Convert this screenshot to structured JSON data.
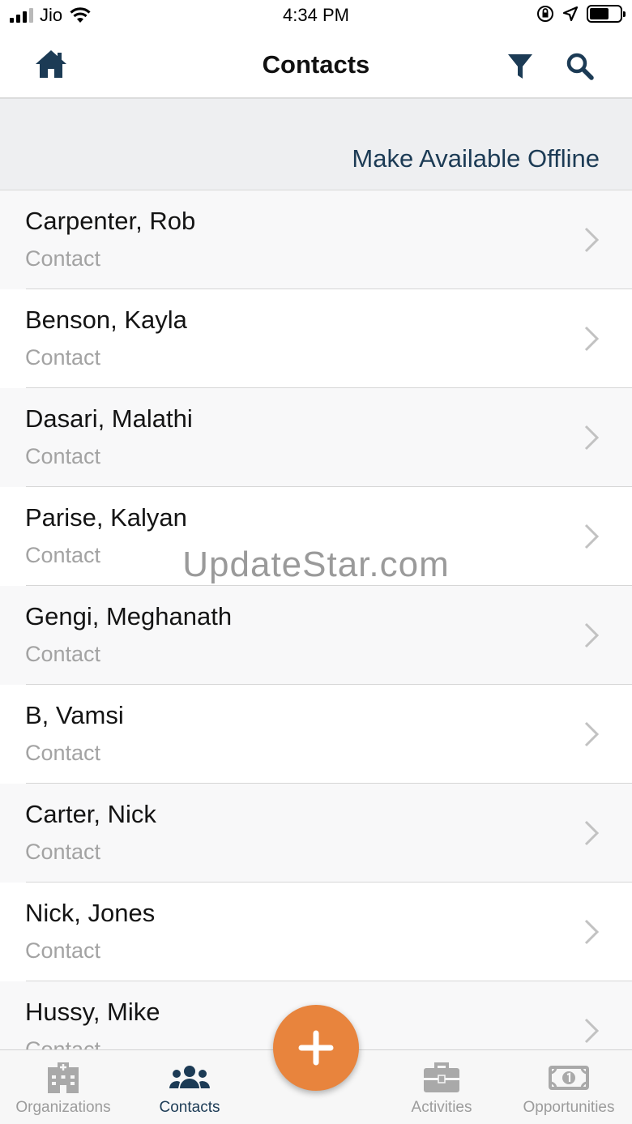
{
  "status_bar": {
    "carrier": "Jio",
    "time": "4:34 PM",
    "battery_level": 0.65
  },
  "nav": {
    "title": "Contacts",
    "icons": [
      "home-icon",
      "filter-icon",
      "search-icon"
    ]
  },
  "offline": {
    "label": "Make Available Offline"
  },
  "contacts": [
    {
      "name": "Carpenter, Rob",
      "type": "Contact"
    },
    {
      "name": "Benson, Kayla",
      "type": "Contact"
    },
    {
      "name": "Dasari, Malathi",
      "type": "Contact"
    },
    {
      "name": "Parise, Kalyan",
      "type": "Contact"
    },
    {
      "name": "Gengi, Meghanath",
      "type": "Contact"
    },
    {
      "name": "B, Vamsi",
      "type": "Contact"
    },
    {
      "name": "Carter, Nick",
      "type": "Contact"
    },
    {
      "name": "Nick, Jones",
      "type": "Contact"
    },
    {
      "name": "Hussy, Mike",
      "type": "Contact"
    }
  ],
  "watermark": "UpdateStar.com",
  "tabs": [
    {
      "label": "Organizations",
      "icon": "building-icon",
      "active": false
    },
    {
      "label": "Contacts",
      "icon": "people-icon",
      "active": true
    },
    {
      "label": "Activities",
      "icon": "briefcase-icon",
      "active": false
    },
    {
      "label": "Opportunities",
      "icon": "money-icon",
      "active": false
    }
  ],
  "fab": {
    "icon": "plus-icon"
  },
  "colors": {
    "accent_navy": "#1c3b55",
    "fab_orange": "#e8843d",
    "muted_gray": "#a3a3a3"
  }
}
